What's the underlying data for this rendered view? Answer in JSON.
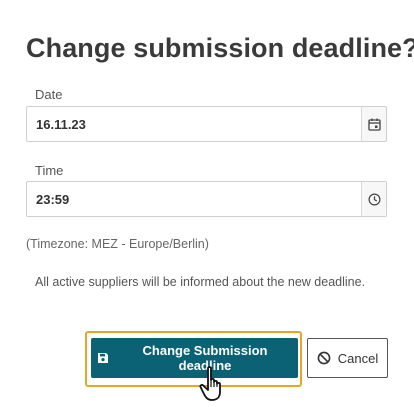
{
  "dialog": {
    "title": "Change submission deadline?",
    "date_label": "Date",
    "date_value": "16.11.23",
    "time_label": "Time",
    "time_value": "23:59",
    "timezone_note": "(Timezone: MEZ - Europe/Berlin)",
    "info_text": "All active suppliers will be informed about the new deadline.",
    "primary_button_label": "Change Submission deadline",
    "cancel_button_label": "Cancel"
  },
  "icons": {
    "date_addon": "calendar-icon",
    "time_addon": "clock-icon",
    "primary_button": "save-icon",
    "cancel_button": "cancel-icon",
    "pointer": "hand-cursor-icon"
  },
  "colors": {
    "primary_button": "#0b6275",
    "focus_highlight": "#e8a526",
    "title": "#3a3a3a"
  }
}
